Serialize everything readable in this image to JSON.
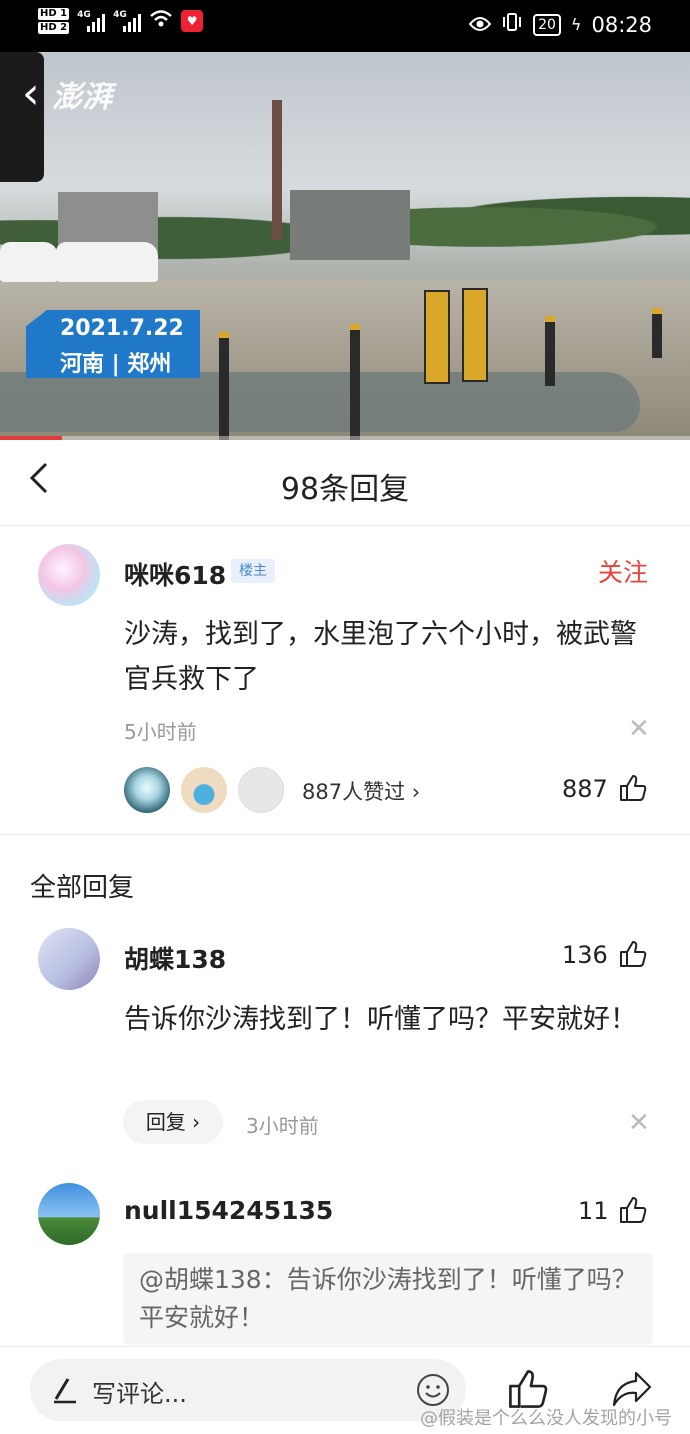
{
  "status_bar": {
    "hd1": "HD 1",
    "hd2": "HD 2",
    "net1": "4G",
    "net2": "4G",
    "battery": "20",
    "time": "08:28"
  },
  "video": {
    "logo": "澎湃",
    "date": "2021.7.22",
    "location": "河南 | 郑州",
    "progress": 0.09
  },
  "header": {
    "title": "98条回复"
  },
  "main_comment": {
    "username": "咪咪618",
    "owner_tag": "楼主",
    "follow_label": "关注",
    "text": "沙涛，找到了，水里泡了六个小时，被武警官兵救下了",
    "time": "5小时前",
    "likers_text": "887人赞过 ›",
    "like_count": "887"
  },
  "section_title": "全部回复",
  "replies": [
    {
      "username": "胡蝶138",
      "like_count": "136",
      "text": "告诉你沙涛找到了！听懂了吗？平安就好！",
      "reply_label": "回复 ›",
      "time": "3小时前"
    },
    {
      "username": "null154245135",
      "like_count": "11",
      "quote": "@胡蝶138：告诉你沙涛找到了！听懂了吗？平安就好！"
    }
  ],
  "bottom_bar": {
    "placeholder": "写评论..."
  },
  "watermark": "@假装是个么么没人发现的小号",
  "colors": {
    "accent_red": "#e8433a",
    "tag_blue": "#1f78c8",
    "owner_tag_text": "#4a86c8"
  },
  "icons": [
    "back-icon",
    "close-icon",
    "thumb-up-icon",
    "edit-pen-icon",
    "emoji-icon",
    "share-icon",
    "wifi-icon",
    "eye-icon",
    "vibrate-icon"
  ]
}
